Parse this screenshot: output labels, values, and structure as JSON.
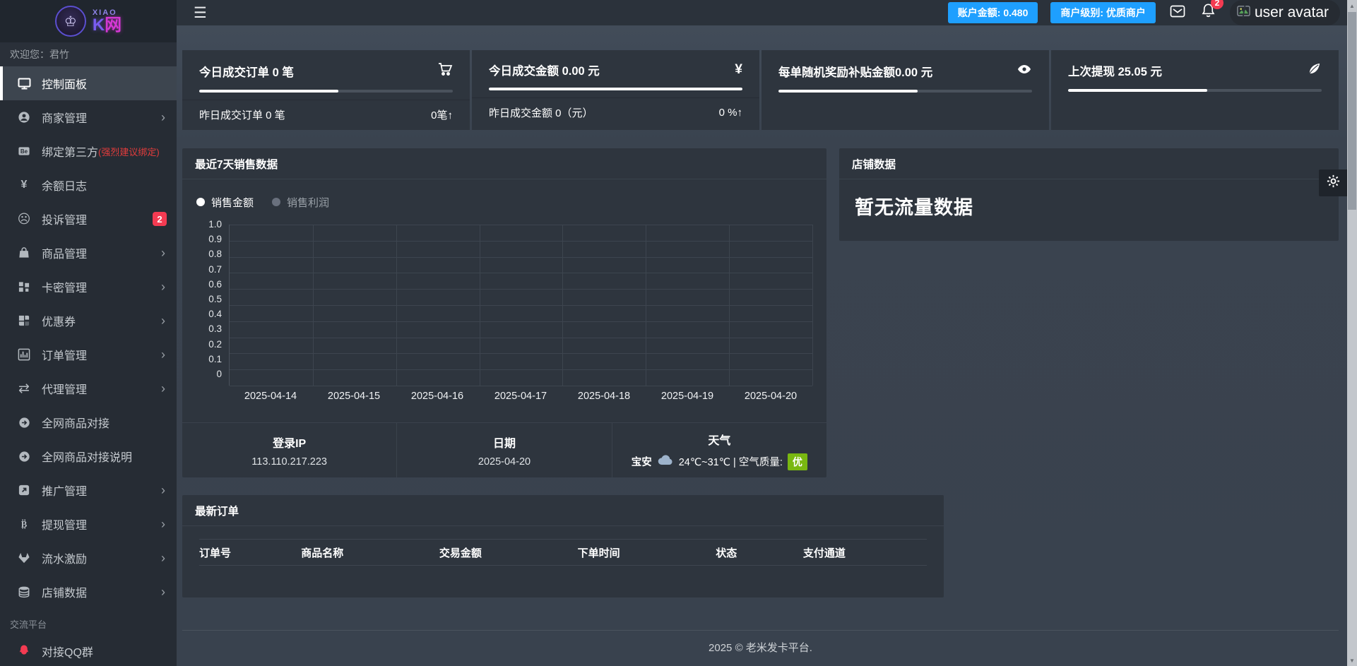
{
  "logo": {
    "brand_small": "XIAO",
    "brand_k": "K",
    "brand_net": "网",
    "glyph": "♔"
  },
  "sidebar": {
    "greeting": "欢迎您：君竹",
    "items": [
      {
        "label": "控制面板",
        "icon": "monitor-icon",
        "active": true
      },
      {
        "label": "商家管理",
        "icon": "user-icon",
        "chevron": "›"
      },
      {
        "label": "绑定第三方",
        "suffix": "(强烈建议绑定)",
        "icon": "behance-icon"
      },
      {
        "label": "余额日志",
        "icon": "yen-icon"
      },
      {
        "label": "投诉管理",
        "badge": "2",
        "icon": "frown-icon"
      },
      {
        "label": "商品管理",
        "icon": "bag-icon",
        "chevron": "›"
      },
      {
        "label": "卡密管理",
        "icon": "card-grid-icon",
        "chevron": "›"
      },
      {
        "label": "优惠券",
        "icon": "coupon-icon",
        "chevron": "›"
      },
      {
        "label": "订单管理",
        "icon": "bar-chart-icon",
        "chevron": "›"
      },
      {
        "label": "代理管理",
        "icon": "swap-icon",
        "chevron": "›"
      },
      {
        "label": "全网商品对接",
        "icon": "arrow-circle-icon"
      },
      {
        "label": "全网商品对接说明",
        "icon": "arrow-circle-icon"
      },
      {
        "label": "推广管理",
        "icon": "share-icon",
        "chevron": "›"
      },
      {
        "label": "提现管理",
        "icon": "bitcoin-icon",
        "chevron": "›"
      },
      {
        "label": "流水激励",
        "icon": "gitlab-icon",
        "chevron": "›"
      },
      {
        "label": "店铺数据",
        "icon": "database-icon",
        "chevron": "›"
      }
    ],
    "section_label": "交流平台",
    "qq_item": "对接QQ群"
  },
  "header": {
    "balance_badge": "账户金额: 0.480",
    "level_badge": "商户级别: 优质商户",
    "bell_count": "2",
    "avatar_alt": "user avatar"
  },
  "stats": [
    {
      "title": "今日成交订单 0 笔",
      "icon": "cart-icon",
      "progress": 55,
      "sub_left": "昨日成交订单 0 笔",
      "sub_right": "0笔↑"
    },
    {
      "title": "今日成交金额 0.00 元",
      "icon": "yen-icon",
      "progress": 100,
      "sub_left": "昨日成交金额 0（元）",
      "sub_right": "0 %↑"
    },
    {
      "title": "每单随机奖励补贴金额0.00 元",
      "icon": "eye-icon",
      "progress": 55
    },
    {
      "title": "上次提现 25.05 元",
      "icon": "quill-icon",
      "progress": 55
    }
  ],
  "chart_card": {
    "title": "最近7天销售数据",
    "info_cells": [
      {
        "label": "登录IP",
        "value": "113.110.217.223"
      },
      {
        "label": "日期",
        "value": "2025-04-20"
      },
      {
        "label": "天气",
        "city": "宝安",
        "value": "24℃~31℃ | 空气质量:",
        "badge": "优"
      }
    ]
  },
  "chart_data": {
    "type": "line",
    "title": "最近7天销售数据",
    "categories": [
      "2025-04-14",
      "2025-04-15",
      "2025-04-16",
      "2025-04-17",
      "2025-04-18",
      "2025-04-19",
      "2025-04-20"
    ],
    "series": [
      {
        "name": "销售金额",
        "dot_color": "#ffffff",
        "text_color": "#ffffff",
        "values": [
          null,
          null,
          null,
          null,
          null,
          null,
          null
        ]
      },
      {
        "name": "销售利润",
        "dot_color": "#69707d",
        "text_color": "#9aa1a8",
        "values": [
          null,
          null,
          null,
          null,
          null,
          null,
          null
        ]
      }
    ],
    "ylim": [
      0,
      1.0
    ],
    "y_ticks": [
      "1.0",
      "0.9",
      "0.8",
      "0.7",
      "0.6",
      "0.5",
      "0.4",
      "0.3",
      "0.2",
      "0.1",
      "0"
    ],
    "grid": true,
    "legend_position": "top-left"
  },
  "shop_card": {
    "title": "店铺数据",
    "empty_text": "暂无流量数据"
  },
  "orders_card": {
    "title": "最新订单",
    "columns": [
      "订单号",
      "商品名称",
      "交易金额",
      "下单时间",
      "状态",
      "支付通道"
    ]
  },
  "footer": {
    "copyright": "2025 © 老米发卡平台."
  },
  "colors": {
    "accent_blue": "#1e9fff",
    "badge_red": "#f43b52",
    "aqi_green": "#79b811",
    "brand_purple": "#7a5cf0",
    "brand_magenta": "#d438d4",
    "progress_white": "#ffffff"
  }
}
